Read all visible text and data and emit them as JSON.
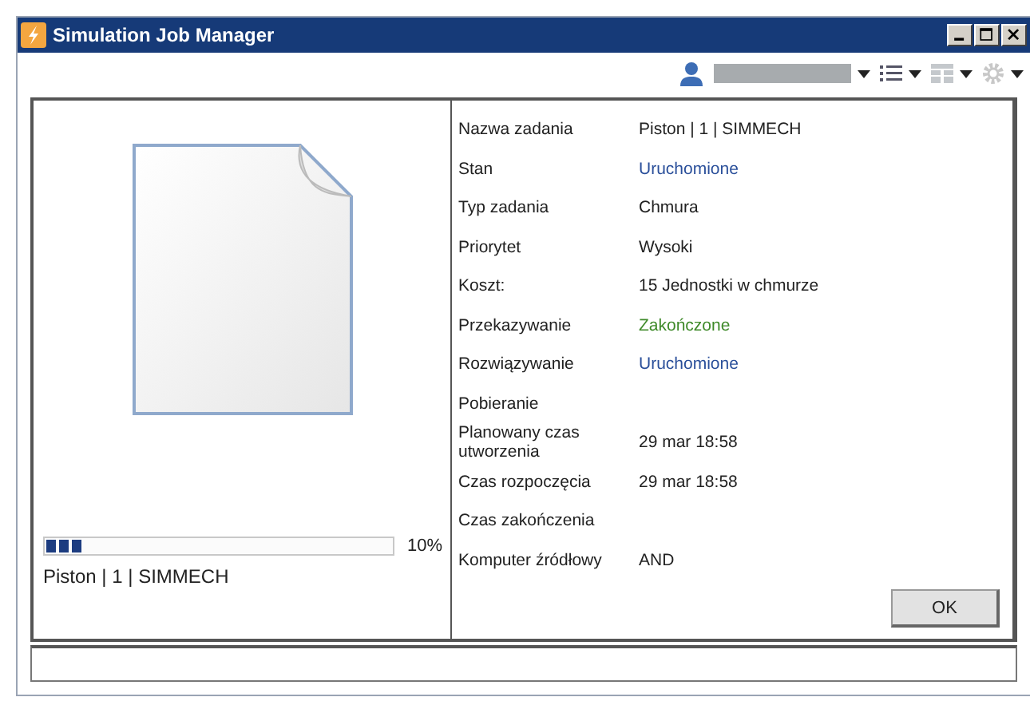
{
  "window": {
    "title": "Simulation Job Manager"
  },
  "job": {
    "level": 0.1,
    "percent": "10%",
    "name": "Piston | 1 | SIMMECH"
  },
  "details": [
    {
      "label": "Nazwa zadania",
      "value": "Piston | 1 | SIMMECH"
    },
    {
      "label": "Stan",
      "value": "Uruchomione",
      "color": "#2a4f9a"
    },
    {
      "label": "Typ zadania",
      "value": "Chmura"
    },
    {
      "label": "Priorytet",
      "value": "Wysoki"
    },
    {
      "label": "Koszt:",
      "value": "15 Jednostki w chmurze"
    },
    {
      "label": "Przekazywanie",
      "value": "Zakończone",
      "color": "#3f8a2a"
    },
    {
      "label": "Rozwiązywanie",
      "value": "Uruchomione",
      "color": "#2a4f9a"
    },
    {
      "label": "Pobieranie"
    },
    {
      "label": "Planowany czas utworzenia",
      "value": "29 mar 18:58"
    },
    {
      "label": "Czas rozpoczęcia",
      "value": "29 mar 18:58"
    },
    {
      "label": "Czas zakończenia"
    },
    {
      "label": "Komputer źródłowy",
      "value": "AND"
    }
  ],
  "buttons": [
    "OK"
  ]
}
